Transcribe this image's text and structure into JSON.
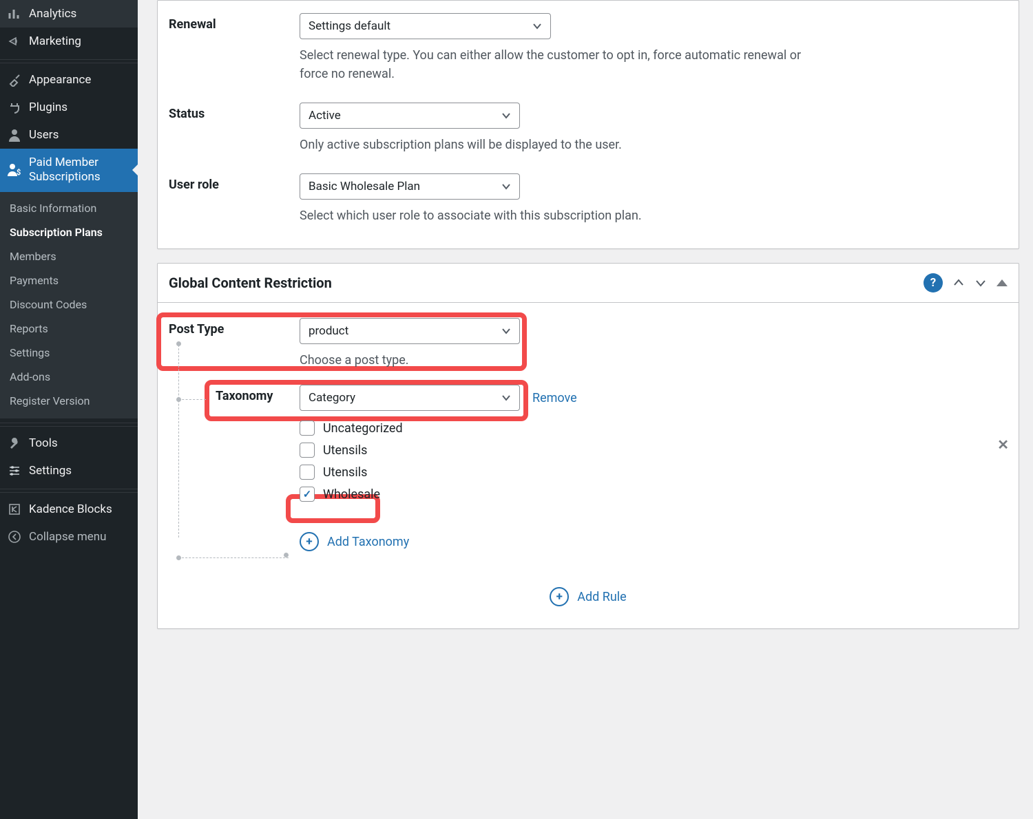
{
  "sidebar": {
    "items": [
      {
        "icon": "analytics",
        "label": "Analytics"
      },
      {
        "icon": "megaphone",
        "label": "Marketing"
      },
      {
        "icon": "brush",
        "label": "Appearance"
      },
      {
        "icon": "plug",
        "label": "Plugins"
      },
      {
        "icon": "user",
        "label": "Users"
      },
      {
        "icon": "user-dollar",
        "label": "Paid Member Subscriptions",
        "active": true
      },
      {
        "icon": "wrench",
        "label": "Tools"
      },
      {
        "icon": "sliders",
        "label": "Settings"
      },
      {
        "icon": "kadence",
        "label": "Kadence Blocks"
      }
    ],
    "submenu": [
      "Basic Information",
      "Subscription Plans",
      "Members",
      "Payments",
      "Discount Codes",
      "Reports",
      "Settings",
      "Add-ons",
      "Register Version"
    ],
    "submenu_current_index": 1,
    "collapse_label": "Collapse menu"
  },
  "top_panel": {
    "fields": {
      "renewal": {
        "label": "Renewal",
        "value": "Settings default",
        "help": "Select renewal type. You can either allow the customer to opt in, force automatic renewal or force no renewal."
      },
      "status": {
        "label": "Status",
        "value": "Active",
        "help": "Only active subscription plans will be displayed to the user."
      },
      "user_role": {
        "label": "User role",
        "value": "Basic Wholesale Plan",
        "help": "Select which user role to associate with this subscription plan."
      }
    }
  },
  "gcr_panel": {
    "title": "Global Content Restriction",
    "help_symbol": "?",
    "post_type": {
      "label": "Post Type",
      "value": "product",
      "help": "Choose a post type."
    },
    "taxonomy": {
      "label": "Taxonomy",
      "value": "Category",
      "remove_label": "Remove",
      "options": [
        {
          "label": "Uncategorized",
          "checked": false
        },
        {
          "label": "Utensils",
          "checked": false
        },
        {
          "label": "Utensils",
          "checked": false
        },
        {
          "label": "Wholesale",
          "checked": true
        }
      ]
    },
    "add_taxonomy_label": "Add Taxonomy",
    "add_rule_label": "Add Rule",
    "close_symbol": "✕",
    "plus_symbol": "+"
  }
}
